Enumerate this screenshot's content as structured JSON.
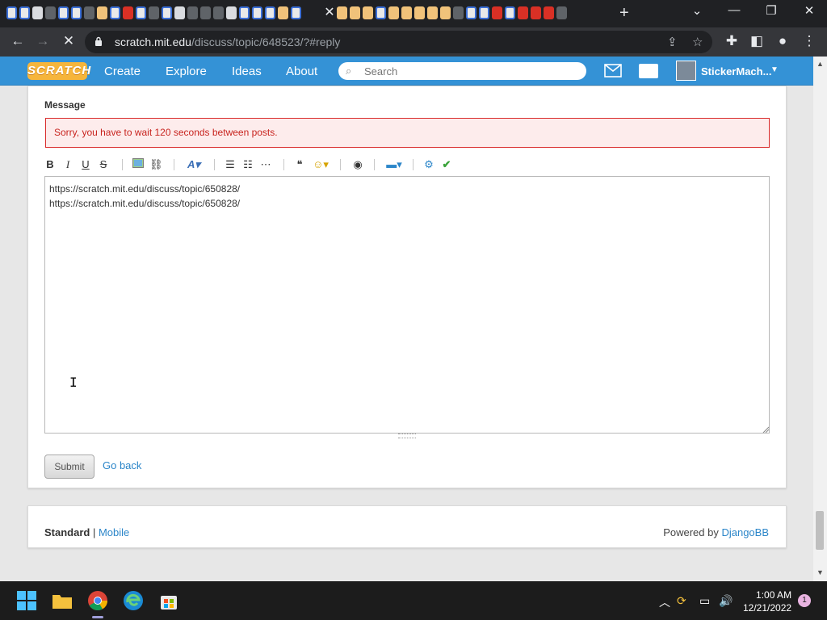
{
  "browser": {
    "url_host": "scratch.mit.edu",
    "url_path": "/discuss/topic/648523/?#reply",
    "tab_close": "✕",
    "new_tab": "+"
  },
  "nav": {
    "logo": "SCRATCH",
    "links": [
      "Create",
      "Explore",
      "Ideas",
      "About"
    ],
    "search_placeholder": "Search",
    "username": "StickerMach..."
  },
  "form": {
    "message_label": "Message",
    "error": "Sorry, you have to wait 120 seconds between posts.",
    "message_text": "https://scratch.mit.edu/discuss/topic/650828/\nhttps://scratch.mit.edu/discuss/topic/650828/",
    "submit_label": "Submit",
    "go_back_label": "Go back"
  },
  "footer": {
    "standard": "Standard",
    "separator": " | ",
    "mobile": "Mobile",
    "powered_by": "Powered by ",
    "djangobb": "DjangoBB"
  },
  "taskbar": {
    "time": "1:00 AM",
    "date": "12/21/2022",
    "notification_count": "1"
  },
  "colors": {
    "scratch_blue": "#3492d6",
    "error_red": "#d92a2a",
    "link_blue": "#2c86c9"
  }
}
